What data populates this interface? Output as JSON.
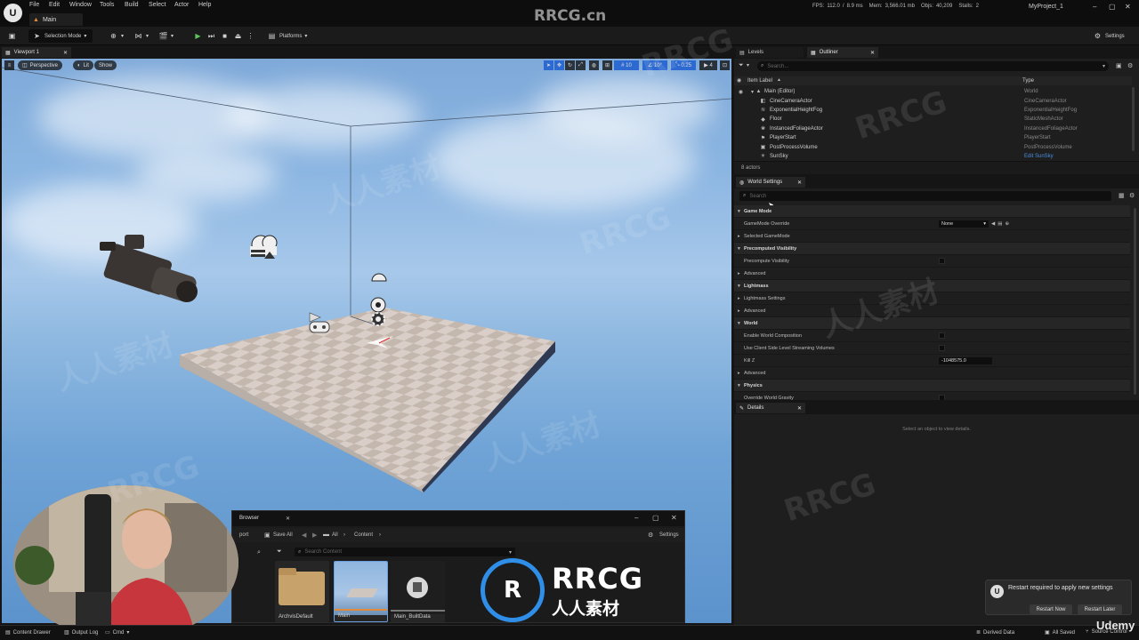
{
  "app": {
    "menu": [
      "File",
      "Edit",
      "Window",
      "Tools",
      "Build",
      "Select",
      "Actor",
      "Help"
    ],
    "level_tab": "Main",
    "project": "MyProject_1",
    "watermark_top": "RRCG.cn",
    "stats": {
      "fps_label": "FPS:",
      "fps": "112.0",
      "ms": "8.9 ms",
      "mem_label": "Mem:",
      "mem": "3,566.01 mb",
      "objs_label": "Objs:",
      "objs": "40,209",
      "stalls_label": "Stalls:",
      "stalls": "2"
    }
  },
  "toolbar": {
    "mode": "Selection Mode",
    "platforms": "Platforms",
    "settings": "Settings"
  },
  "viewport": {
    "tab": "Viewport 1",
    "perspective": "Perspective",
    "lit": "Lit",
    "show": "Show",
    "grid": "10",
    "angle": "10°",
    "scale": "0.25",
    "camera_speed": "4"
  },
  "outliner": {
    "tabs": [
      "Levels",
      "Outliner"
    ],
    "search_placeholder": "Search...",
    "col_label": "Item Label",
    "col_type": "Type",
    "rows": [
      {
        "label": "Main (Editor)",
        "type": "World",
        "icon": "level-icon"
      },
      {
        "label": "CineCameraActor",
        "type": "CineCameraActor",
        "icon": "camera-icon"
      },
      {
        "label": "ExponentialHeightFog",
        "type": "ExponentialHeightFog",
        "icon": "fog-icon"
      },
      {
        "label": "Floor",
        "type": "StaticMeshActor",
        "icon": "mesh-icon"
      },
      {
        "label": "InstancedFoliageActor",
        "type": "InstancedFoliageActor",
        "icon": "foliage-icon"
      },
      {
        "label": "PlayerStart",
        "type": "PlayerStart",
        "icon": "flag-icon"
      },
      {
        "label": "PostProcessVolume",
        "type": "PostProcessVolume",
        "icon": "volume-icon"
      },
      {
        "label": "SunSky",
        "type": "Edit SunSky",
        "icon": "sun-icon"
      }
    ],
    "count": "8 actors"
  },
  "world_settings": {
    "tab": "World Settings",
    "search_placeholder": "Search",
    "rows": [
      {
        "kind": "cat",
        "name": "Game Mode"
      },
      {
        "kind": "item",
        "name": "GameMode Override",
        "value_type": "dropdown",
        "value": "None"
      },
      {
        "kind": "item",
        "name": "Selected GameMode",
        "collapsed": true
      },
      {
        "kind": "cat",
        "name": "Precomputed Visibility"
      },
      {
        "kind": "item",
        "name": "Precompute Visibility",
        "value_type": "checkbox"
      },
      {
        "kind": "item",
        "name": "Advanced",
        "collapsed": true
      },
      {
        "kind": "cat",
        "name": "Lightmass"
      },
      {
        "kind": "item",
        "name": "Lightmass Settings",
        "collapsed": true
      },
      {
        "kind": "item",
        "name": "Advanced",
        "collapsed": true
      },
      {
        "kind": "cat",
        "name": "World"
      },
      {
        "kind": "item",
        "name": "Enable World Composition",
        "value_type": "checkbox"
      },
      {
        "kind": "item",
        "name": "Use Client Side Level Streaming Volumes",
        "value_type": "checkbox"
      },
      {
        "kind": "item",
        "name": "Kill Z",
        "value_type": "number",
        "value": "-1048575.0"
      },
      {
        "kind": "item",
        "name": "Advanced",
        "collapsed": true
      },
      {
        "kind": "cat",
        "name": "Physics"
      },
      {
        "kind": "item",
        "name": "Override World Gravity",
        "value_type": "checkbox"
      }
    ]
  },
  "details": {
    "tab": "Details",
    "empty_text": "Select an object to view details."
  },
  "content_browser": {
    "title": "Browser",
    "import": "port",
    "save_all": "Save All",
    "path": [
      "All",
      "Content"
    ],
    "settings": "Settings",
    "search_placeholder": "Search Content",
    "assets": [
      {
        "name": "ArchvisDefault",
        "kind": "folder"
      },
      {
        "name": "Main",
        "kind": "level"
      },
      {
        "name": "Main_BuiltData",
        "kind": "data"
      }
    ]
  },
  "statusbar": {
    "content_drawer": "Content Drawer",
    "output_log": "Output Log",
    "cmd": "Cmd",
    "derived_data": "Derived Data",
    "all_saved": "All Saved",
    "source_control": "Source Control"
  },
  "notification": {
    "message": "Restart required to apply new settings",
    "restart_now": "Restart Now",
    "restart_later": "Restart Later"
  },
  "watermarks": {
    "rrcg": "RRCG",
    "cn": "人人素材",
    "udemy": "Udemy"
  }
}
